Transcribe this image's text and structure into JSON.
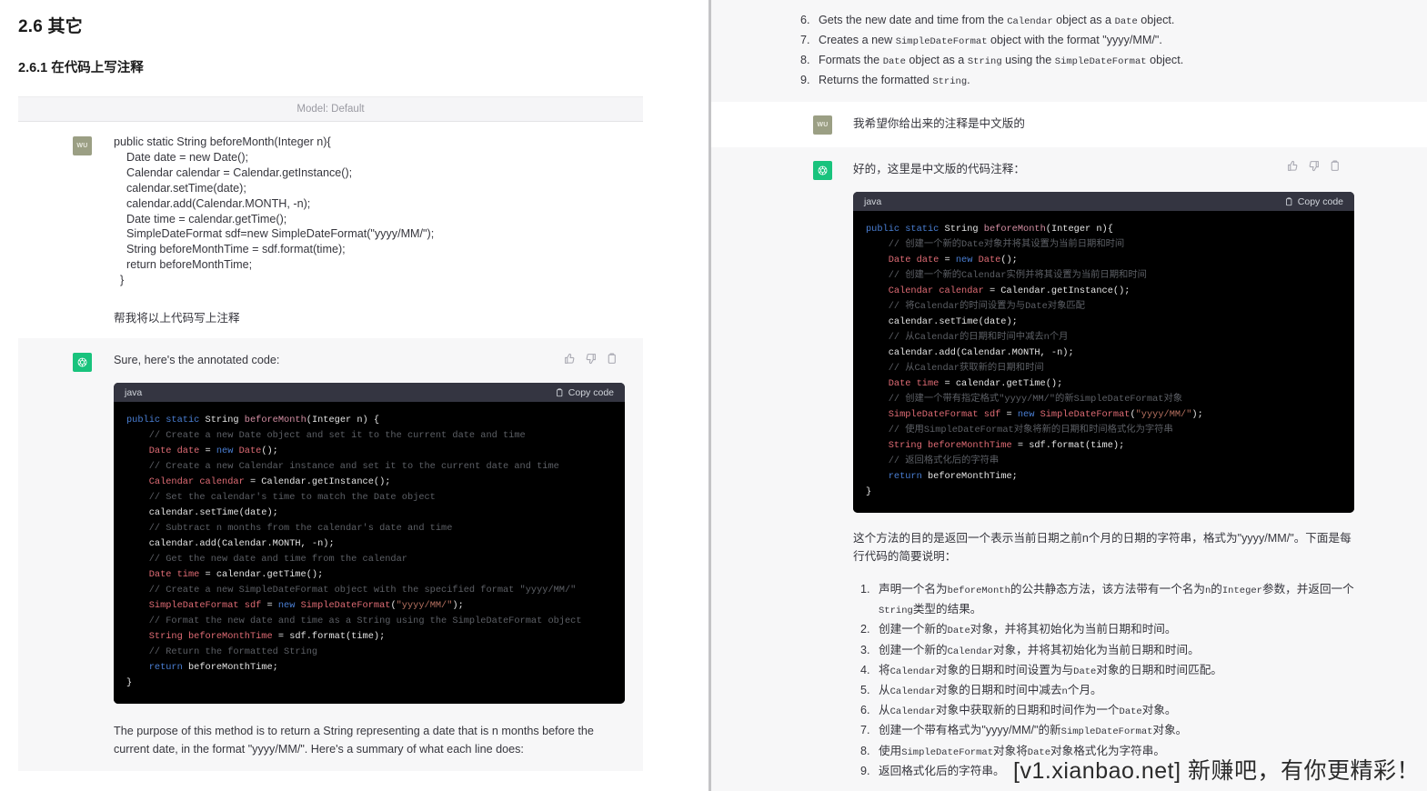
{
  "document": {
    "heading_number": "2.6",
    "heading_title": "其它",
    "subheading": "2.6.1 在代码上写注释",
    "model_label": "Model: Default"
  },
  "left_column": {
    "user_message": {
      "avatar_initials": "WU",
      "code": "public static String beforeMonth(Integer n){\n    Date date = new Date();\n    Calendar calendar = Calendar.getInstance();\n    calendar.setTime(date);\n    calendar.add(Calendar.MONTH, -n);\n    Date time = calendar.getTime();\n    SimpleDateFormat sdf=new SimpleDateFormat(\"yyyy/MM/\");\n    String beforeMonthTime = sdf.format(time);\n    return beforeMonthTime;\n  }",
      "prompt": "帮我将以上代码写上注释"
    },
    "assistant_message": {
      "intro": "Sure, here's the annotated code:",
      "code_lang": "java",
      "copy_label": "Copy code",
      "summary": "The purpose of this method is to return a String representing a date that is n months before the current date, in the format \"yyyy/MM/\". Here's a summary of what each line does:",
      "code_lines": [
        {
          "indent": 0,
          "parts": [
            {
              "t": "kw",
              "s": "public static "
            },
            {
              "t": "pl",
              "s": "String "
            },
            {
              "t": "fn",
              "s": "beforeMonth"
            },
            {
              "t": "pl",
              "s": "(Integer n) {"
            }
          ]
        },
        {
          "indent": 1,
          "parts": [
            {
              "t": "cmt",
              "s": "// Create a new Date object and set it to the current date and time"
            }
          ]
        },
        {
          "indent": 1,
          "parts": [
            {
              "t": "typ",
              "s": "Date date "
            },
            {
              "t": "pl",
              "s": "= "
            },
            {
              "t": "kw",
              "s": "new "
            },
            {
              "t": "typ",
              "s": "Date"
            },
            {
              "t": "pl",
              "s": "();"
            }
          ]
        },
        {
          "indent": 1,
          "parts": [
            {
              "t": "cmt",
              "s": "// Create a new Calendar instance and set it to the current date and time"
            }
          ]
        },
        {
          "indent": 1,
          "parts": [
            {
              "t": "typ",
              "s": "Calendar calendar "
            },
            {
              "t": "pl",
              "s": "= Calendar.getInstance();"
            }
          ]
        },
        {
          "indent": 1,
          "parts": [
            {
              "t": "cmt",
              "s": "// Set the calendar's time to match the Date object"
            }
          ]
        },
        {
          "indent": 1,
          "parts": [
            {
              "t": "pl",
              "s": "calendar.setTime(date);"
            }
          ]
        },
        {
          "indent": 1,
          "parts": [
            {
              "t": "cmt",
              "s": "// Subtract n months from the calendar's date and time"
            }
          ]
        },
        {
          "indent": 1,
          "parts": [
            {
              "t": "pl",
              "s": "calendar.add(Calendar.MONTH, -n);"
            }
          ]
        },
        {
          "indent": 1,
          "parts": [
            {
              "t": "cmt",
              "s": "// Get the new date and time from the calendar"
            }
          ]
        },
        {
          "indent": 1,
          "parts": [
            {
              "t": "typ",
              "s": "Date time "
            },
            {
              "t": "pl",
              "s": "= calendar.getTime();"
            }
          ]
        },
        {
          "indent": 1,
          "parts": [
            {
              "t": "cmt",
              "s": "// Create a new SimpleDateFormat object with the specified format \"yyyy/MM/\""
            }
          ]
        },
        {
          "indent": 1,
          "parts": [
            {
              "t": "typ",
              "s": "SimpleDateFormat sdf "
            },
            {
              "t": "pl",
              "s": "= "
            },
            {
              "t": "kw",
              "s": "new "
            },
            {
              "t": "typ",
              "s": "SimpleDateFormat"
            },
            {
              "t": "pl",
              "s": "("
            },
            {
              "t": "str",
              "s": "\"yyyy/MM/\""
            },
            {
              "t": "pl",
              "s": ");"
            }
          ]
        },
        {
          "indent": 1,
          "parts": [
            {
              "t": "cmt",
              "s": "// Format the new date and time as a String using the SimpleDateFormat object"
            }
          ]
        },
        {
          "indent": 1,
          "parts": [
            {
              "t": "typ",
              "s": "String beforeMonthTime "
            },
            {
              "t": "pl",
              "s": "= sdf.format(time);"
            }
          ]
        },
        {
          "indent": 1,
          "parts": [
            {
              "t": "cmt",
              "s": "// Return the formatted String"
            }
          ]
        },
        {
          "indent": 1,
          "parts": [
            {
              "t": "kw",
              "s": "return "
            },
            {
              "t": "pl",
              "s": "beforeMonthTime;"
            }
          ]
        },
        {
          "indent": 0,
          "parts": [
            {
              "t": "pl",
              "s": "}"
            }
          ]
        }
      ]
    }
  },
  "right_column": {
    "top_list_start": 6,
    "top_list": [
      "Gets the new date and time from the `Calendar` object as a `Date` object.",
      "Creates a new `SimpleDateFormat` object with the format \"yyyy/MM/\".",
      "Formats the `Date` object as a `String` using the `SimpleDateFormat` object.",
      "Returns the formatted `String`."
    ],
    "user_message": {
      "avatar_initials": "WU",
      "text": "我希望你给出来的注释是中文版的"
    },
    "assistant_message": {
      "intro": "好的，这里是中文版的代码注释：",
      "code_lang": "java",
      "copy_label": "Copy code",
      "summary": "这个方法的目的是返回一个表示当前日期之前n个月的日期的字符串，格式为\"yyyy/MM/\"。下面是每行代码的简要说明：",
      "code_lines": [
        {
          "indent": 0,
          "parts": [
            {
              "t": "kw",
              "s": "public static "
            },
            {
              "t": "pl",
              "s": "String "
            },
            {
              "t": "fn",
              "s": "beforeMonth"
            },
            {
              "t": "pl",
              "s": "(Integer n){"
            }
          ]
        },
        {
          "indent": 1,
          "parts": [
            {
              "t": "cmt",
              "s": "// 创建一个新的Date对象并将其设置为当前日期和时间"
            }
          ]
        },
        {
          "indent": 1,
          "parts": [
            {
              "t": "typ",
              "s": "Date date "
            },
            {
              "t": "pl",
              "s": "= "
            },
            {
              "t": "kw",
              "s": "new "
            },
            {
              "t": "typ",
              "s": "Date"
            },
            {
              "t": "pl",
              "s": "();"
            }
          ]
        },
        {
          "indent": 1,
          "parts": [
            {
              "t": "cmt",
              "s": "// 创建一个新的Calendar实例并将其设置为当前日期和时间"
            }
          ]
        },
        {
          "indent": 1,
          "parts": [
            {
              "t": "typ",
              "s": "Calendar calendar "
            },
            {
              "t": "pl",
              "s": "= Calendar.getInstance();"
            }
          ]
        },
        {
          "indent": 1,
          "parts": [
            {
              "t": "cmt",
              "s": "// 将Calendar的时间设置为与Date对象匹配"
            }
          ]
        },
        {
          "indent": 1,
          "parts": [
            {
              "t": "pl",
              "s": "calendar.setTime(date);"
            }
          ]
        },
        {
          "indent": 1,
          "parts": [
            {
              "t": "cmt",
              "s": "// 从Calendar的日期和时间中减去n个月"
            }
          ]
        },
        {
          "indent": 1,
          "parts": [
            {
              "t": "pl",
              "s": "calendar.add(Calendar.MONTH, -n);"
            }
          ]
        },
        {
          "indent": 1,
          "parts": [
            {
              "t": "cmt",
              "s": "// 从Calendar获取新的日期和时间"
            }
          ]
        },
        {
          "indent": 1,
          "parts": [
            {
              "t": "typ",
              "s": "Date time "
            },
            {
              "t": "pl",
              "s": "= calendar.getTime();"
            }
          ]
        },
        {
          "indent": 1,
          "parts": [
            {
              "t": "cmt",
              "s": "// 创建一个带有指定格式\"yyyy/MM/\"的新SimpleDateFormat对象"
            }
          ]
        },
        {
          "indent": 1,
          "parts": [
            {
              "t": "typ",
              "s": "SimpleDateFormat sdf "
            },
            {
              "t": "pl",
              "s": "= "
            },
            {
              "t": "kw",
              "s": "new "
            },
            {
              "t": "typ",
              "s": "SimpleDateFormat"
            },
            {
              "t": "pl",
              "s": "("
            },
            {
              "t": "str",
              "s": "\"yyyy/MM/\""
            },
            {
              "t": "pl",
              "s": ");"
            }
          ]
        },
        {
          "indent": 1,
          "parts": [
            {
              "t": "cmt",
              "s": "// 使用SimpleDateFormat对象将新的日期和时间格式化为字符串"
            }
          ]
        },
        {
          "indent": 1,
          "parts": [
            {
              "t": "typ",
              "s": "String beforeMonthTime "
            },
            {
              "t": "pl",
              "s": "= sdf.format(time);"
            }
          ]
        },
        {
          "indent": 1,
          "parts": [
            {
              "t": "cmt",
              "s": "// 返回格式化后的字符串"
            }
          ]
        },
        {
          "indent": 1,
          "parts": [
            {
              "t": "kw",
              "s": "return "
            },
            {
              "t": "pl",
              "s": "beforeMonthTime;"
            }
          ]
        },
        {
          "indent": 0,
          "parts": [
            {
              "t": "pl",
              "s": "}"
            }
          ]
        }
      ],
      "steps": [
        "声明一个名为`beforeMonth`的公共静态方法，该方法带有一个名为`n`的`Integer`参数，并返回一个`String`类型的结果。",
        "创建一个新的`Date`对象，并将其初始化为当前日期和时间。",
        "创建一个新的`Calendar`对象，并将其初始化为当前日期和时间。",
        "将`Calendar`对象的日期和时间设置为与`Date`对象的日期和时间匹配。",
        "从`Calendar`对象的日期和时间中减去`n`个月。",
        "从`Calendar`对象中获取新的日期和时间作为一个`Date`对象。",
        "创建一个带有格式为\"yyyy/MM/\"的新`SimpleDateFormat`对象。",
        "使用`SimpleDateFormat`对象将`Date`对象格式化为字符串。",
        "返回格式化后的字符串。"
      ]
    }
  },
  "watermark": {
    "text": "[v1.xianbao.net] 新赚吧，有你更精彩！"
  },
  "colors": {
    "accent_green": "#19c37d",
    "user_avatar": "#9b9f84",
    "code_header": "#343541",
    "code_background": "#000000",
    "assistant_background": "#f7f7f8"
  }
}
